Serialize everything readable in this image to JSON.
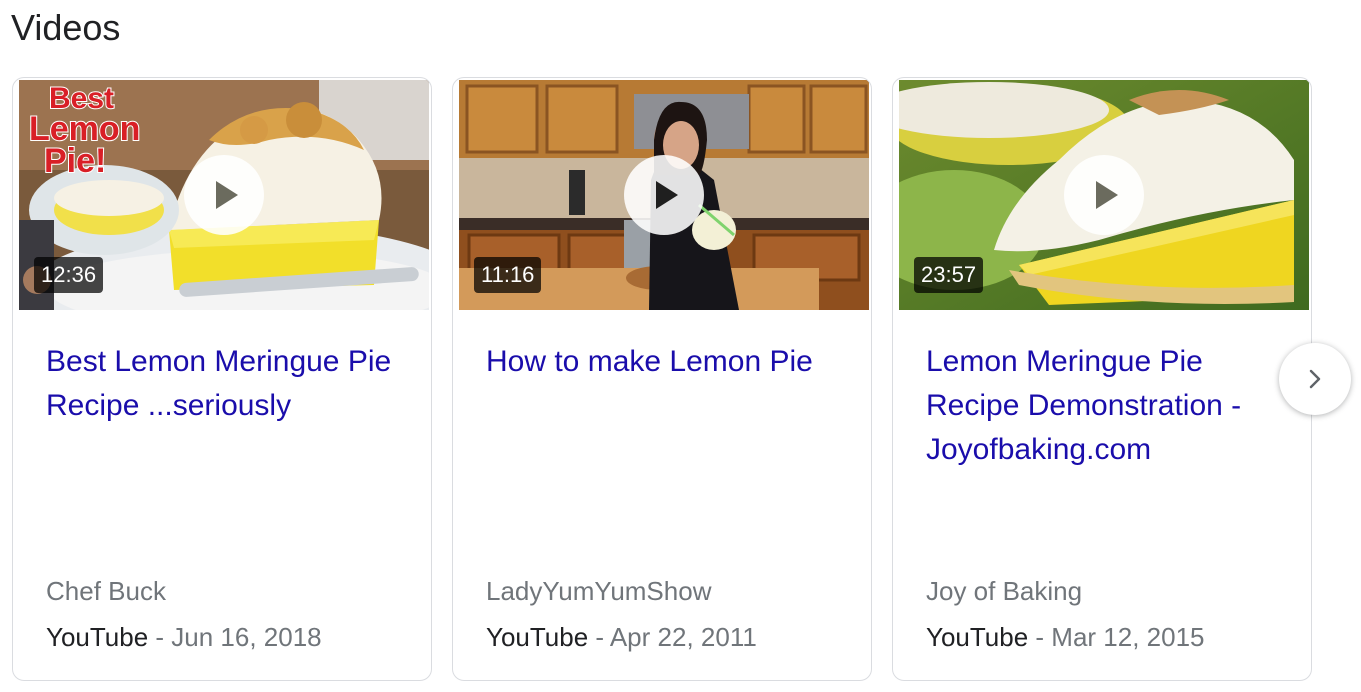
{
  "section": {
    "title": "Videos"
  },
  "videos": [
    {
      "title": "Best Lemon Meringue Pie Recipe ...seriously",
      "duration": "12:36",
      "channel": "Chef Buck",
      "source": "YouTube",
      "separator": " - ",
      "date": "Jun 16, 2018",
      "thumb_overlay_text": [
        "Best",
        "Lemon",
        "Pie!"
      ]
    },
    {
      "title": "How to make Lemon Pie",
      "duration": "11:16",
      "channel": "LadyYumYumShow",
      "source": "YouTube",
      "separator": " - ",
      "date": "Apr 22, 2011"
    },
    {
      "title": "Lemon Meringue Pie Recipe Demonstration - Joyofbaking.com",
      "duration": "23:57",
      "channel": "Joy of Baking",
      "source": "YouTube",
      "separator": " - ",
      "date": "Mar 12, 2015"
    }
  ],
  "icons": {
    "play": "play-icon",
    "next": "chevron-right-icon"
  },
  "colors": {
    "link": "#1a0dab",
    "muted": "#70757a",
    "text": "#202124"
  }
}
